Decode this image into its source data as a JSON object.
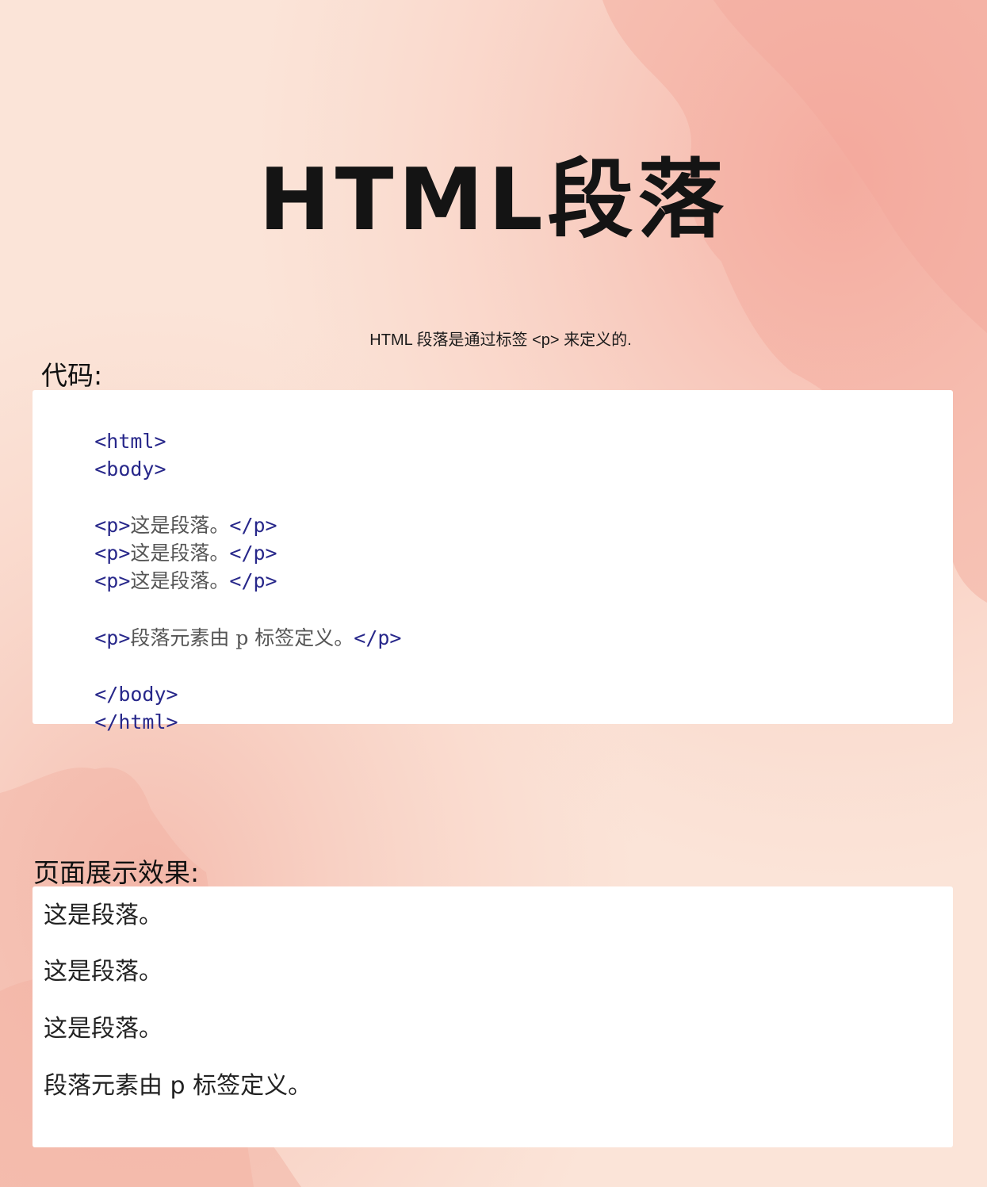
{
  "title": "HTML段落",
  "subtitle": "HTML 段落是通过标签 <p> 来定义的.",
  "code_label": "代码:",
  "code": {
    "html_open": "<html>",
    "body_open": "<body>",
    "p_open": "<p>",
    "p_close": "</p>",
    "p1_text": "这是段落。",
    "p2_text": "这是段落。",
    "p3_text": "这是段落。",
    "p4_text": "段落元素由 p 标签定义。",
    "body_close": "</body>",
    "html_close": "</html>"
  },
  "result_label": "页面展示效果:",
  "result": {
    "lines": [
      "这是段落。",
      "这是段落。",
      "这是段落。",
      "段落元素由 p 标签定义。"
    ]
  },
  "colors": {
    "background": "#fbe3d6",
    "watercolor": "#f2b8aa",
    "tag": "#27278a",
    "code_text": "#555555"
  }
}
